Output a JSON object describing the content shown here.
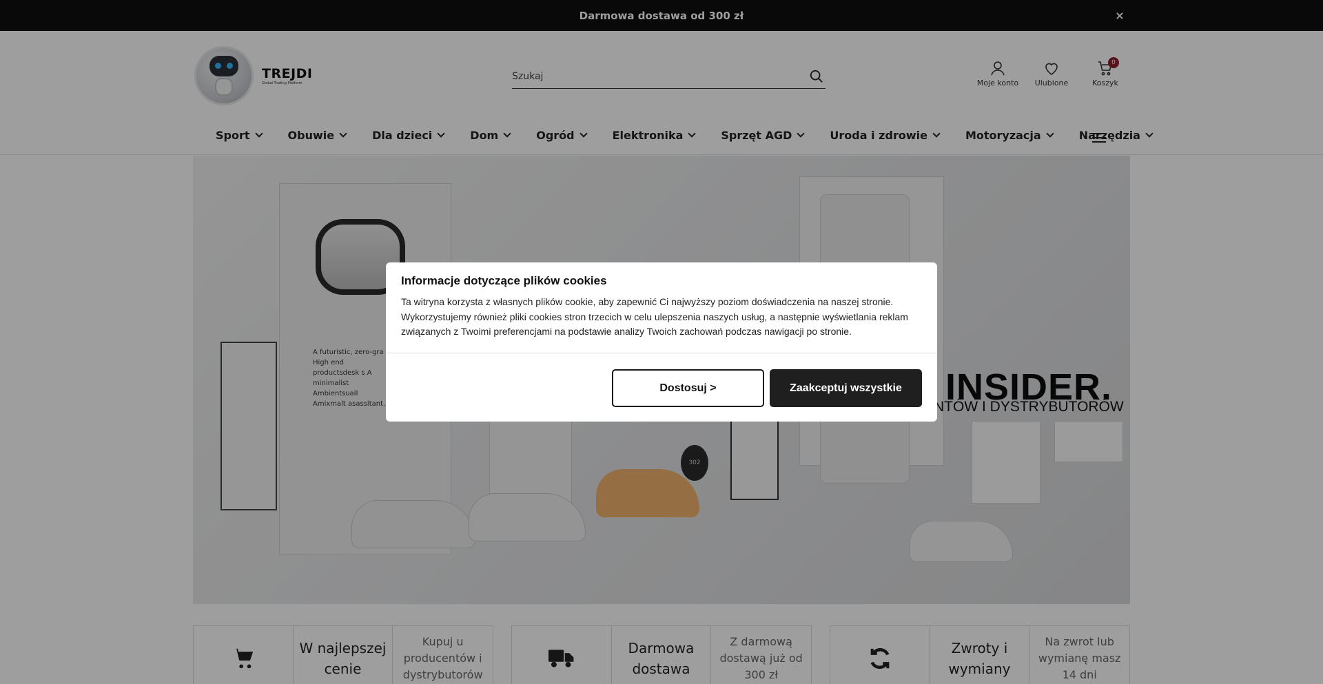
{
  "topbar": {
    "message": "Darmowa dostawa od 300 zł",
    "close": "×"
  },
  "logo": {
    "name": "TREJDI",
    "tagline": "Global Trading Platform"
  },
  "search": {
    "placeholder": "Szukaj"
  },
  "actions": {
    "account": "Moje konto",
    "favorites": "Ulubione",
    "cart": "Koszyk",
    "cart_count": "0"
  },
  "nav": {
    "items": [
      "Sport",
      "Obuwie",
      "Dla dzieci",
      "Dom",
      "Ogród",
      "Elektronika",
      "Sprzęt AGD",
      "Uroda i zdrowie",
      "Motoryzacja",
      "Narzędzia"
    ]
  },
  "hero": {
    "headline": "INSIDER.",
    "subline": "NTÓW I DYSTRYBUTORÓW",
    "note": "A futuristic, zero-gra High end productsdesk s A minimalist Ambientsuall Amixmalt asassitant."
  },
  "features": [
    {
      "icon": "cart-icon",
      "title": "W najlepszej cenie",
      "desc": "Kupuj u producentów i dystrybutorów"
    },
    {
      "icon": "truck-icon",
      "title": "Darmowa dostawa",
      "desc": "Z darmową dostawą już od 300 zł"
    },
    {
      "icon": "refresh-icon",
      "title": "Zwroty i wymiany",
      "desc": "Na zwrot lub wymianę masz 14 dni"
    }
  ],
  "cookie": {
    "title": "Informacje dotyczące plików cookies",
    "text": "Ta witryna korzysta z własnych plików cookie, aby zapewnić Ci najwyższy poziom doświadczenia na naszej stronie. Wykorzystujemy również pliki cookies stron trzecich w celu ulepszenia naszych usług, a następnie wyświetlania reklam związanych z Twoimi preferencjami na podstawie analizy Twoich zachowań podczas nawigacji po stronie.",
    "customize_label": "Dostosuj >",
    "accept_label": "Zaakceptuj wszystkie"
  },
  "colors": {
    "topbar": "#101010",
    "badge": "#8b1e2a",
    "accept": "#1f1f1f"
  }
}
